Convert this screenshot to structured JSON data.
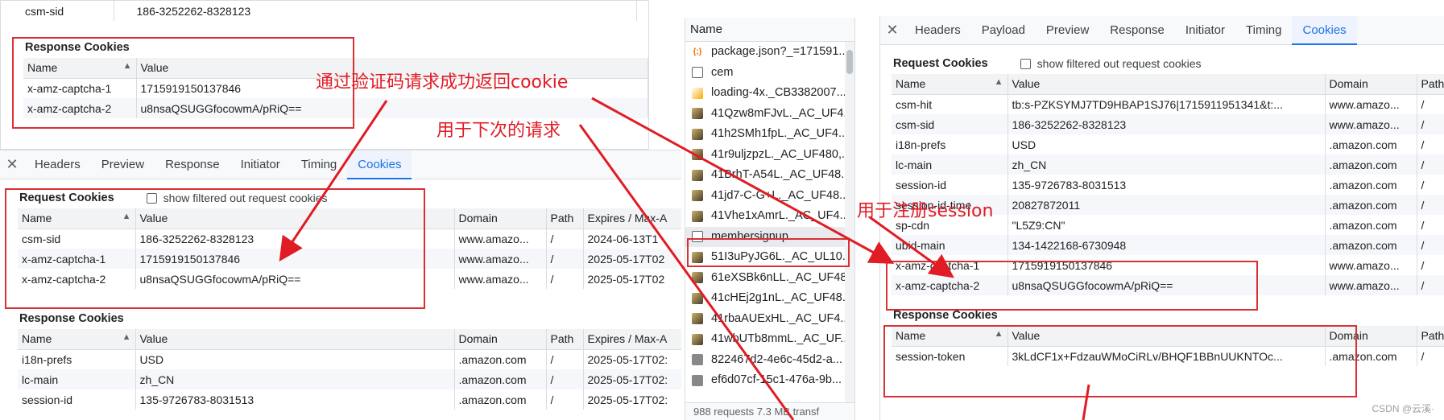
{
  "top_left_popup": {
    "csm_sid_row": {
      "name": "csm-sid",
      "value": "186-3252262-8328123"
    },
    "response_cookies_title": "Response Cookies",
    "headers": {
      "name": "Name",
      "value": "Value"
    },
    "rows": [
      {
        "name": "x-amz-captcha-1",
        "value": "1715919150137846"
      },
      {
        "name": "x-amz-captcha-2",
        "value": "u8nsaQSUGGfocowmA/pRiQ=="
      }
    ]
  },
  "left_panel": {
    "tabs": [
      "Headers",
      "Preview",
      "Response",
      "Initiator",
      "Timing",
      "Cookies"
    ],
    "active_tab": "Cookies",
    "request_cookies_title": "Request Cookies",
    "show_filtered": "show filtered out request cookies",
    "headers": {
      "name": "Name",
      "value": "Value",
      "domain": "Domain",
      "path": "Path",
      "expires": "Expires / Max-A"
    },
    "request_rows": [
      {
        "name": "csm-sid",
        "value": "186-3252262-8328123",
        "domain": "www.amazo...",
        "path": "/",
        "expires": "2024-06-13T1"
      },
      {
        "name": "x-amz-captcha-1",
        "value": "1715919150137846",
        "domain": "www.amazo...",
        "path": "/",
        "expires": "2025-05-17T02"
      },
      {
        "name": "x-amz-captcha-2",
        "value": "u8nsaQSUGGfocowmA/pRiQ==",
        "domain": "www.amazo...",
        "path": "/",
        "expires": "2025-05-17T02"
      }
    ],
    "response_cookies_title": "Response Cookies",
    "response_rows": [
      {
        "name": "i18n-prefs",
        "value": "USD",
        "domain": ".amazon.com",
        "path": "/",
        "expires": "2025-05-17T02:"
      },
      {
        "name": "lc-main",
        "value": "zh_CN",
        "domain": ".amazon.com",
        "path": "/",
        "expires": "2025-05-17T02:"
      },
      {
        "name": "session-id",
        "value": "135-9726783-8031513",
        "domain": ".amazon.com",
        "path": "/",
        "expires": "2025-05-17T02:"
      }
    ]
  },
  "request_list": {
    "header": "Name",
    "items": [
      {
        "label": "package.json?_=171591...",
        "icon": "json"
      },
      {
        "label": "cem",
        "icon": "doc"
      },
      {
        "label": "loading-4x._CB3382007...",
        "icon": "gif"
      },
      {
        "label": "41Qzw8mFJvL._AC_UF4...",
        "icon": "img"
      },
      {
        "label": "41h2SMh1fpL._AC_UF4...",
        "icon": "img"
      },
      {
        "label": "41r9uljzpzL._AC_UF480,...",
        "icon": "img"
      },
      {
        "label": "41BrhT-A54L._AC_UF48...",
        "icon": "img"
      },
      {
        "label": "41jd7-C-G+L._AC_UF48...",
        "icon": "img"
      },
      {
        "label": "41Vhe1xAmrL._AC_UF4...",
        "icon": "img"
      },
      {
        "label": "membersignup",
        "icon": "doc"
      },
      {
        "label": "51I3uPyJG6L._AC_UL10...",
        "icon": "img"
      },
      {
        "label": "61eXSBk6nLL._AC_UF48...",
        "icon": "img"
      },
      {
        "label": "41cHEj2g1nL._AC_UF48...",
        "icon": "img"
      },
      {
        "label": "41rbaAUExHL._AC_UF4...",
        "icon": "img"
      },
      {
        "label": "41wbUTb8mmL._AC_UF...",
        "icon": "img"
      },
      {
        "label": "822467d2-4e6c-45d2-a...",
        "icon": "other"
      },
      {
        "label": "ef6d07cf-15c1-476a-9b...",
        "icon": "other"
      }
    ],
    "footer": "988 requests   7.3 MB transf"
  },
  "right_panel": {
    "tabs": [
      "Headers",
      "Payload",
      "Preview",
      "Response",
      "Initiator",
      "Timing",
      "Cookies"
    ],
    "active_tab": "Cookies",
    "request_cookies_title": "Request Cookies",
    "show_filtered": "show filtered out request cookies",
    "headers": {
      "name": "Name",
      "value": "Value",
      "domain": "Domain",
      "path": "Path"
    },
    "request_rows": [
      {
        "name": "csm-hit",
        "value": "tb:s-PZKSYMJ7TD9HBAP1SJ76|1715911951341&t:...",
        "domain": "www.amazo...",
        "path": "/"
      },
      {
        "name": "csm-sid",
        "value": "186-3252262-8328123",
        "domain": "www.amazo...",
        "path": "/"
      },
      {
        "name": "i18n-prefs",
        "value": "USD",
        "domain": ".amazon.com",
        "path": "/"
      },
      {
        "name": "lc-main",
        "value": "zh_CN",
        "domain": ".amazon.com",
        "path": "/"
      },
      {
        "name": "session-id",
        "value": "135-9726783-8031513",
        "domain": ".amazon.com",
        "path": "/"
      },
      {
        "name": "session-id-time",
        "value": "20827872011",
        "domain": ".amazon.com",
        "path": "/"
      },
      {
        "name": "sp-cdn",
        "value": "\"L5Z9:CN\"",
        "domain": ".amazon.com",
        "path": "/"
      },
      {
        "name": "ubid-main",
        "value": "134-1422168-6730948",
        "domain": ".amazon.com",
        "path": "/"
      },
      {
        "name": "x-amz-captcha-1",
        "value": "1715919150137846",
        "domain": "www.amazo...",
        "path": "/"
      },
      {
        "name": "x-amz-captcha-2",
        "value": "u8nsaQSUGGfocowmA/pRiQ==",
        "domain": "www.amazo...",
        "path": "/"
      }
    ],
    "response_cookies_title": "Response Cookies",
    "response_rows": [
      {
        "name": "session-token",
        "value": "3kLdCF1x+FdzauWMoCiRLv/BHQF1BBnUUKNTOc...",
        "domain": ".amazon.com",
        "path": "/"
      }
    ]
  },
  "annotations": {
    "note1": "通过验证码请求成功返回cookie",
    "note2": "用于下次的请求",
    "note3": "用于注册session"
  },
  "watermark": "CSDN @云溪·",
  "colors": {
    "annotation_red": "#e01c25",
    "active_tab_blue": "#1a73e8"
  }
}
